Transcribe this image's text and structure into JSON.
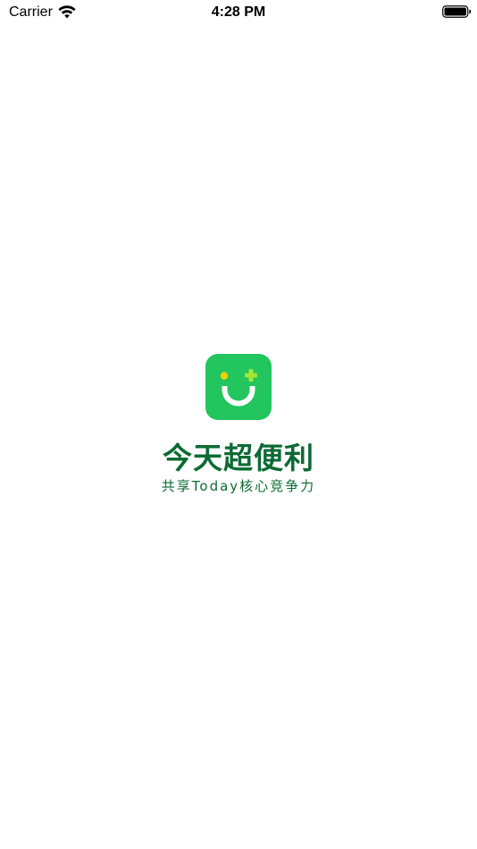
{
  "status_bar": {
    "carrier": "Carrier",
    "time": "4:28 PM",
    "wifi_icon": "wifi-icon",
    "battery_icon": "battery-icon"
  },
  "splash": {
    "app_icon": "smiley-face-icon",
    "brand_name": "今天超便利",
    "slogan": "共享Today核心竞争力"
  },
  "colors": {
    "icon_green": "#22c55e",
    "brand_text": "#0b6b33",
    "eye_yellow": "#f5d000",
    "plus_green": "#a3e635"
  }
}
